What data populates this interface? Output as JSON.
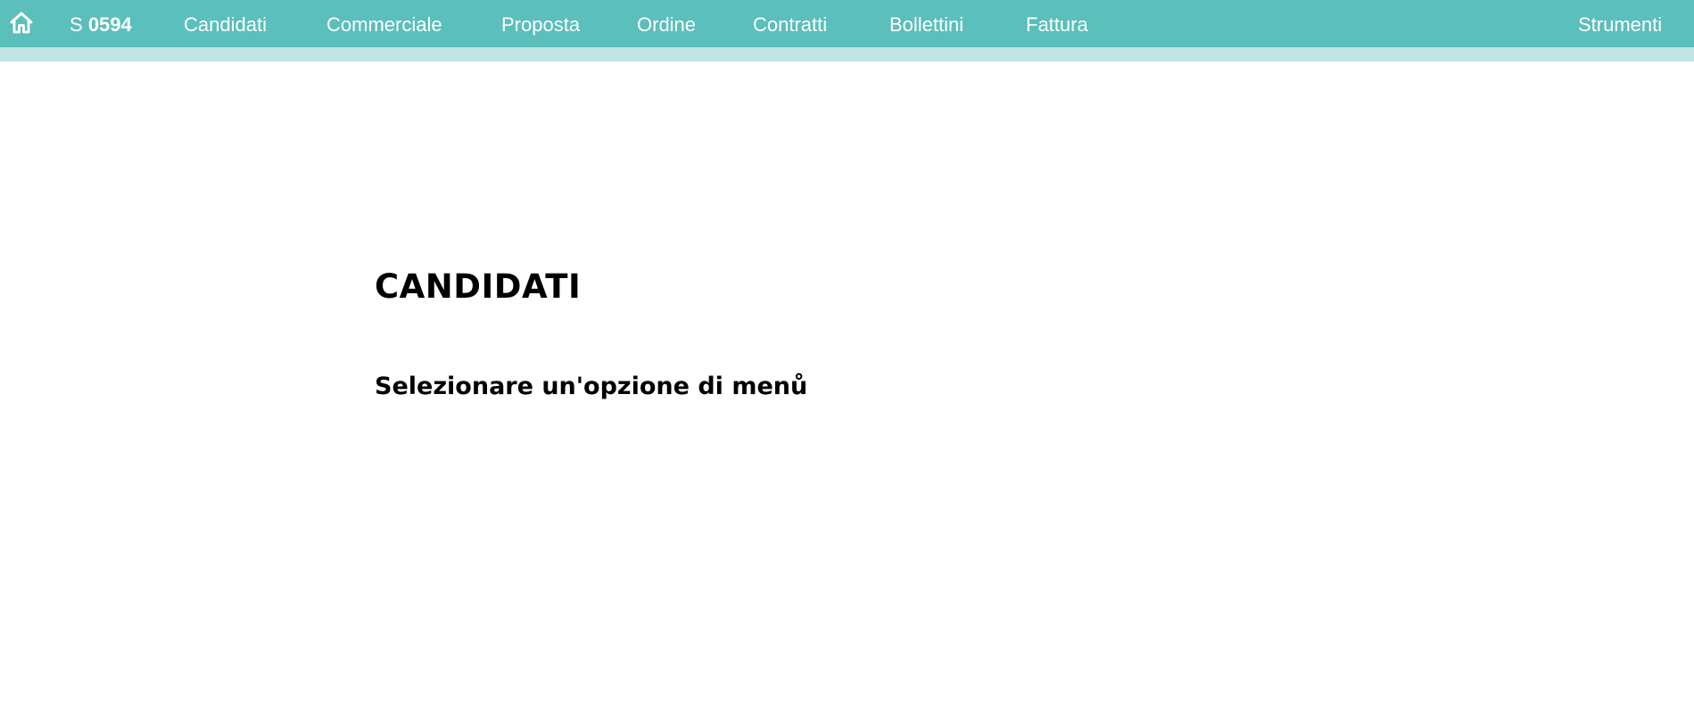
{
  "colors": {
    "nav_background": "#5bbfbc",
    "subbar_background": "#bfe6e4",
    "nav_text": "#ffffff",
    "page_text": "#000000"
  },
  "nav": {
    "home_icon": "home-icon",
    "brand_prefix": "S",
    "brand_number": "0594",
    "items": [
      {
        "label": "Candidati"
      },
      {
        "label": "Commerciale"
      },
      {
        "label": "Proposta"
      },
      {
        "label": "Ordine"
      },
      {
        "label": "Contratti"
      },
      {
        "label": "Bollettini"
      },
      {
        "label": "Fattura"
      }
    ],
    "tools_label": "Strumenti"
  },
  "main": {
    "title": "CANDIDATI",
    "subtitle": "Selezionare un'opzione di menů"
  }
}
